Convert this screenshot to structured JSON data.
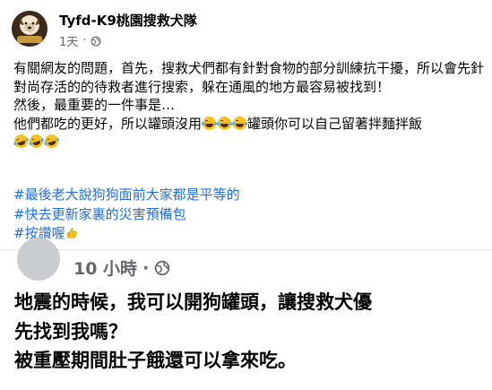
{
  "post": {
    "author": "Tyfd-K9桃園搜救犬隊",
    "avatar_logo_text": "TYFDK9",
    "timestamp": "1天",
    "separator": "·",
    "audience_icon": "globe-icon",
    "lines": [
      "有關網友的問題，首先，搜救犬們都有針對食物的部分訓練抗干擾，所以會先針對尚存活的的待救者進行搜索，躲在通風的地方最容易被找到！",
      "然後，最重要的一件事是…"
    ],
    "line3_before": "他們都吃的更好，所以罐頭沒用",
    "line3_after": "罐頭你可以自己留著拌麵拌飯",
    "emoji_name": "laughing-tears-emoji",
    "hashtags": [
      "#最後老大說狗狗面前大家都是平等的",
      "#快去更新家裏的災害預備包",
      "#按讚喔"
    ],
    "thumb_icon": "thumbs-up-emoji"
  },
  "shared": {
    "timestamp": "10 小時",
    "separator": "·",
    "lines": [
      "地震的時候，我可以開狗罐頭，讓搜救犬優",
      "先找到我嗎？",
      "被重壓期間肚子餓還可以拿來吃。"
    ]
  },
  "colors": {
    "text": "#050505",
    "meta": "#65676b",
    "hashtag": "#216fdb",
    "emoji": "#f5c021"
  }
}
